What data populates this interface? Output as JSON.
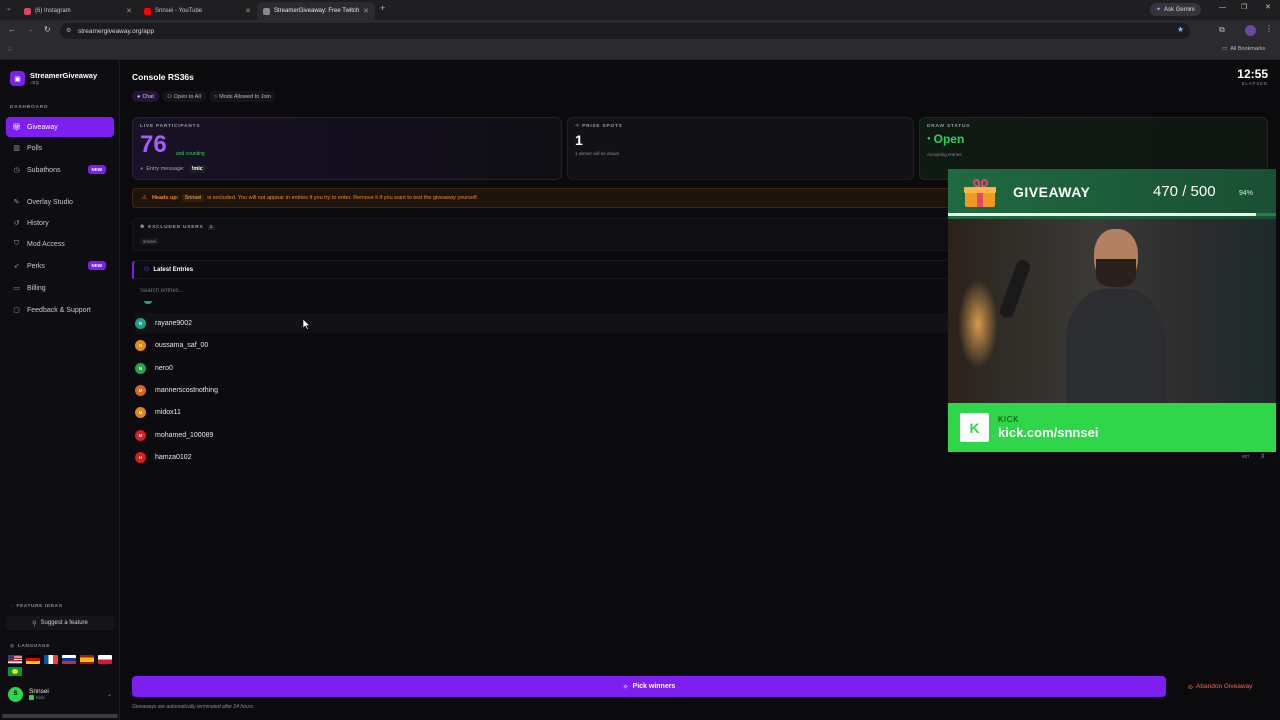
{
  "browser": {
    "tabs": [
      {
        "label": "(6) Instagram",
        "color": "#e4405f"
      },
      {
        "label": "Snnsei - YouTube",
        "color": "#ff0000"
      },
      {
        "label": "StreamerGiveaway: Free Twitch",
        "color": "#8a8a8a"
      }
    ],
    "ask_gemini": "Ask Gemini",
    "url": "streamergiveaway.org/app",
    "all_bookmarks": "All Bookmarks"
  },
  "sidebar": {
    "brand_name": "StreamerGiveaway",
    "brand_sub": ".org",
    "section": "DASHBOARD",
    "items": [
      {
        "label": "Giveaway",
        "icon": "gift-icon",
        "active": true
      },
      {
        "label": "Polls",
        "icon": "poll-icon"
      },
      {
        "label": "Subathons",
        "icon": "clock-icon",
        "badge": "NEW"
      },
      {
        "label": "Overlay Studio",
        "icon": "brush-icon"
      },
      {
        "label": "History",
        "icon": "history-icon"
      },
      {
        "label": "Mod Access",
        "icon": "shield-icon"
      },
      {
        "label": "Perks",
        "icon": "rocket-icon",
        "badge": "NEW"
      },
      {
        "label": "Billing",
        "icon": "card-icon"
      },
      {
        "label": "Feedback & Support",
        "icon": "message-icon"
      }
    ],
    "feature_ideas": "FEATURE IDEAS",
    "suggest": "Suggest a feature",
    "language": "LANGUAGE",
    "user_name": "Snnsei",
    "user_platform": "Kick"
  },
  "main": {
    "title": "Console RS36s",
    "pills": [
      "Chat",
      "Open to All",
      "Mods Allowed to Join"
    ],
    "timer": "12:55",
    "timer_label": "ELAPSED",
    "cards": {
      "participants_label": "LIVE PARTICIPANTS",
      "participants_value": "76",
      "participants_sub": "and counting",
      "entry_message_label": "Entry message:",
      "entry_message": "!mic",
      "prize_label": "PRIZE SPOTS",
      "prize_value": "1",
      "prize_sub": "1 winner will be drawn",
      "draw_label": "DRAW STATUS",
      "draw_value": "Open",
      "draw_sub": "Accepting entries"
    },
    "headsup_label": "Heads up:",
    "headsup_name": "Snnsei",
    "headsup_text": "is excluded. You will not appear in entries if you try to enter. Remove it if you want to test the giveaway yourself.",
    "excluded_label": "EXCLUDED USERS",
    "excluded_count": "1",
    "excluded_user": "snnsei",
    "latest_entries": "Latest Entries",
    "search_placeholder": "Search entries...",
    "entries": [
      {
        "name": "rayane9002",
        "initial": "R",
        "color": "#1f9c8a"
      },
      {
        "name": "oussama_saf_00",
        "initial": "O",
        "color": "#e08e0b"
      },
      {
        "name": "nero0",
        "initial": "N",
        "color": "#23a447"
      },
      {
        "name": "mannerscostnothing",
        "initial": "M",
        "color": "#e0641b"
      },
      {
        "name": "midox11",
        "initial": "M",
        "color": "#e0861b"
      },
      {
        "name": "mohamed_100089",
        "initial": "M",
        "color": "#d61f1f"
      },
      {
        "name": "hamza0102",
        "initial": "H",
        "color": "#d61f1f"
      }
    ],
    "entry_count": "#27",
    "pick_winners": "Pick winners",
    "abandon": "Abandon Giveaway",
    "footnote": "Giveaways are automatically terminated after 24 hours."
  },
  "overlay": {
    "title": "GIVEAWAY",
    "count": "470 / 500",
    "percent": "94%",
    "progress": 0.94,
    "platform": "KICK",
    "channel": "kick.com/snnsei"
  },
  "colors": {
    "accent": "#7c1ff0",
    "open_green": "#29d65a",
    "kick_green": "#2fd64a"
  }
}
